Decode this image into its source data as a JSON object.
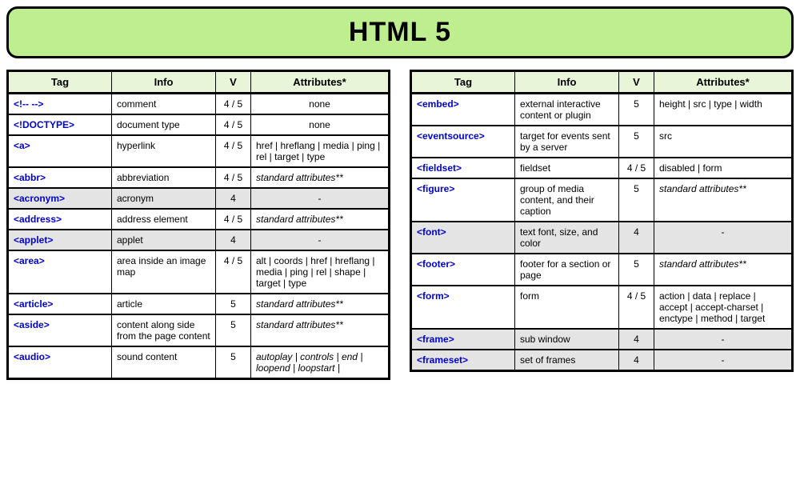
{
  "page_title": "HTML 5",
  "headers": {
    "tag": "Tag",
    "info": "Info",
    "v": "V",
    "attrs": "Attributes*"
  },
  "std_attrs_label": "standard attributes**",
  "left": [
    {
      "tag": "<!-- -->",
      "info": "comment",
      "v": "4 / 5",
      "attrs": "none",
      "attr_center": true
    },
    {
      "tag": "<!DOCTYPE>",
      "info": "document type",
      "v": "4 / 5",
      "attrs": "none",
      "attr_center": true
    },
    {
      "tag": "<a>",
      "info": "hyperlink",
      "v": "4 / 5",
      "attrs": "href | hreflang | media | ping | rel | target | type"
    },
    {
      "tag": "<abbr>",
      "info": "abbreviation",
      "v": "4 / 5",
      "attrs": "standard attributes**",
      "italic": true
    },
    {
      "tag": "<acronym>",
      "info": "acronym",
      "v": "4",
      "attrs": "-",
      "attr_center": true,
      "deprecated": true
    },
    {
      "tag": "<address>",
      "info": "address element",
      "v": "4 / 5",
      "attrs": "standard attributes**",
      "italic": true
    },
    {
      "tag": "<applet>",
      "info": "applet",
      "v": "4",
      "attrs": "-",
      "attr_center": true,
      "deprecated": true
    },
    {
      "tag": "<area>",
      "info": "area inside an image map",
      "v": "4 / 5",
      "attrs": "alt | coords | href | hreflang | media | ping | rel | shape | target | type"
    },
    {
      "tag": "<article>",
      "info": "article",
      "v": "5",
      "attrs": "standard attributes**",
      "italic": true
    },
    {
      "tag": "<aside>",
      "info": "content along side from the page content",
      "v": "5",
      "attrs": "standard attributes**",
      "italic": true
    },
    {
      "tag": "<audio>",
      "info": "sound content",
      "v": "5",
      "attrs": "autoplay | controls | end | loopend | loopstart |",
      "italic": true
    }
  ],
  "right": [
    {
      "tag": "<embed>",
      "info": "external interactive content or plugin",
      "v": "5",
      "attrs": "height | src | type | width"
    },
    {
      "tag": "<eventsource>",
      "info": "target for events sent by a server",
      "v": "5",
      "attrs": "src"
    },
    {
      "tag": "<fieldset>",
      "info": "fieldset",
      "v": "4 / 5",
      "attrs": "disabled | form"
    },
    {
      "tag": "<figure>",
      "info": "group of media content, and their caption",
      "v": "5",
      "attrs": "standard attributes**",
      "italic": true
    },
    {
      "tag": "<font>",
      "info": "text font, size, and color",
      "v": "4",
      "attrs": "-",
      "attr_center": true,
      "deprecated": true
    },
    {
      "tag": "<footer>",
      "info": "footer for a section or page",
      "v": "5",
      "attrs": "standard attributes**",
      "italic": true
    },
    {
      "tag": "<form>",
      "info": "form",
      "v": "4 / 5",
      "attrs": "action | data | replace | accept | accept-charset | enctype | method | target"
    },
    {
      "tag": "<frame>",
      "info": "sub window",
      "v": "4",
      "attrs": "-",
      "attr_center": true,
      "deprecated": true
    },
    {
      "tag": "<frameset>",
      "info": "set of frames",
      "v": "4",
      "attrs": "-",
      "attr_center": true,
      "deprecated": true
    }
  ]
}
